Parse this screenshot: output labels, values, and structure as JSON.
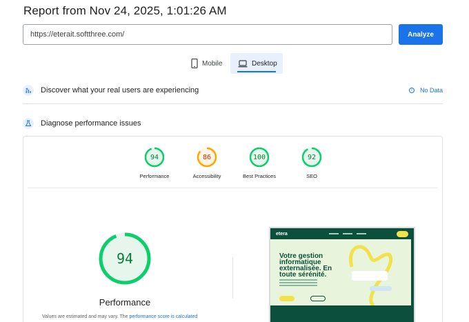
{
  "report": {
    "title": "Report from Nov 24, 2025, 1:01:26 AM"
  },
  "search": {
    "url": "https://eterait.softthree.com/",
    "analyze_label": "Analyze"
  },
  "tabs": [
    {
      "label": "Mobile",
      "icon": "smartphone-icon",
      "active": false
    },
    {
      "label": "Desktop",
      "icon": "laptop-icon",
      "active": true
    }
  ],
  "crux": {
    "text": "Discover what your real users are experiencing",
    "status": "No Data"
  },
  "diagnose": {
    "text": "Diagnose performance issues"
  },
  "scores": [
    {
      "label": "Performance",
      "score": "94",
      "color": "#0cce6b"
    },
    {
      "label": "Accessibility",
      "score": "86",
      "color": "#ffa400"
    },
    {
      "label": "Best Practices",
      "score": "100",
      "color": "#0cce6b"
    },
    {
      "label": "SEO",
      "score": "92",
      "color": "#0cce6b"
    }
  ],
  "performance": {
    "score": "94",
    "label": "Performance",
    "note_prefix": "Values are estimated and may vary. The ",
    "note_link": "performance score is calculated"
  },
  "screenshot": {
    "logo": "etera",
    "headline": "Votre gestion informatique externalisée. En toute sérénité."
  },
  "colors": {
    "accent": "#1a73e8",
    "pass": "#0cce6b",
    "average": "#ffa400"
  }
}
